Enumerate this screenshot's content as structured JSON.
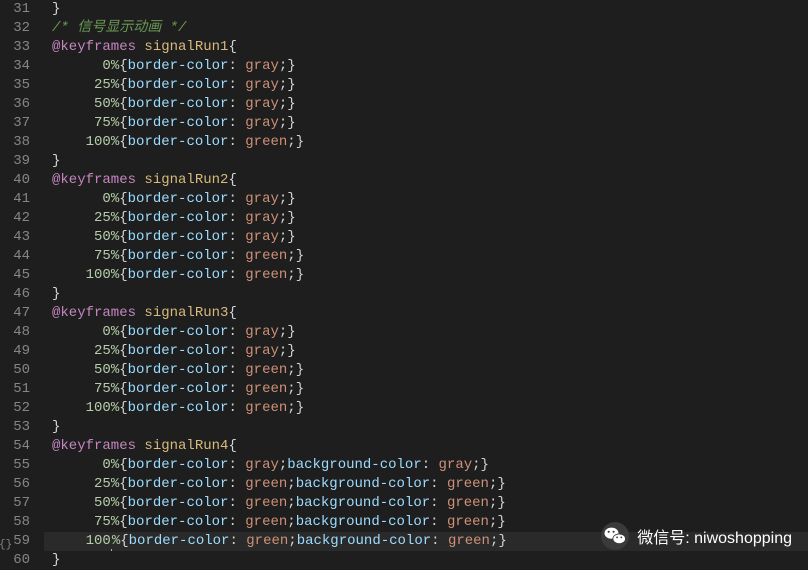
{
  "watermark": {
    "label": "微信号: niwoshopping"
  },
  "gutter": {
    "start": 31,
    "end": 60
  },
  "lines": [
    {
      "n": 31,
      "ind": 1,
      "tokens": [
        [
          "brace",
          "}"
        ]
      ]
    },
    {
      "n": 32,
      "ind": 1,
      "tokens": [
        [
          "comment",
          "/* 信号显示动画 */"
        ]
      ]
    },
    {
      "n": 33,
      "ind": 1,
      "tokens": [
        [
          "keyword",
          "@keyframes"
        ],
        [
          "sp",
          " "
        ],
        [
          "selector",
          "signalRun1"
        ],
        [
          "brace",
          "{"
        ]
      ]
    },
    {
      "n": 34,
      "ind": 3,
      "tokens": [
        [
          "num",
          "0"
        ],
        [
          "pct",
          "%"
        ],
        [
          "brace",
          "{"
        ],
        [
          "prop",
          "border-color"
        ],
        [
          "colon",
          ": "
        ],
        [
          "value",
          "gray"
        ],
        [
          "semi",
          ";"
        ],
        [
          "brace",
          "}"
        ]
      ]
    },
    {
      "n": 35,
      "ind": 3,
      "tokens": [
        [
          "num",
          "25"
        ],
        [
          "pct",
          "%"
        ],
        [
          "brace",
          "{"
        ],
        [
          "prop",
          "border-color"
        ],
        [
          "colon",
          ": "
        ],
        [
          "value",
          "gray"
        ],
        [
          "semi",
          ";"
        ],
        [
          "brace",
          "}"
        ]
      ]
    },
    {
      "n": 36,
      "ind": 3,
      "tokens": [
        [
          "num",
          "50"
        ],
        [
          "pct",
          "%"
        ],
        [
          "brace",
          "{"
        ],
        [
          "prop",
          "border-color"
        ],
        [
          "colon",
          ": "
        ],
        [
          "value",
          "gray"
        ],
        [
          "semi",
          ";"
        ],
        [
          "brace",
          "}"
        ]
      ]
    },
    {
      "n": 37,
      "ind": 3,
      "tokens": [
        [
          "num",
          "75"
        ],
        [
          "pct",
          "%"
        ],
        [
          "brace",
          "{"
        ],
        [
          "prop",
          "border-color"
        ],
        [
          "colon",
          ": "
        ],
        [
          "value",
          "gray"
        ],
        [
          "semi",
          ";"
        ],
        [
          "brace",
          "}"
        ]
      ]
    },
    {
      "n": 38,
      "ind": 3,
      "tokens": [
        [
          "num",
          "100"
        ],
        [
          "pct",
          "%"
        ],
        [
          "brace",
          "{"
        ],
        [
          "prop",
          "border-color"
        ],
        [
          "colon",
          ": "
        ],
        [
          "value",
          "green"
        ],
        [
          "semi",
          ";"
        ],
        [
          "brace",
          "}"
        ]
      ]
    },
    {
      "n": 39,
      "ind": 1,
      "tokens": [
        [
          "brace",
          "}"
        ]
      ]
    },
    {
      "n": 40,
      "ind": 1,
      "tokens": [
        [
          "keyword",
          "@keyframes"
        ],
        [
          "sp",
          " "
        ],
        [
          "selector",
          "signalRun2"
        ],
        [
          "brace",
          "{"
        ]
      ]
    },
    {
      "n": 41,
      "ind": 3,
      "tokens": [
        [
          "num",
          "0"
        ],
        [
          "pct",
          "%"
        ],
        [
          "brace",
          "{"
        ],
        [
          "prop",
          "border-color"
        ],
        [
          "colon",
          ": "
        ],
        [
          "value",
          "gray"
        ],
        [
          "semi",
          ";"
        ],
        [
          "brace",
          "}"
        ]
      ]
    },
    {
      "n": 42,
      "ind": 3,
      "tokens": [
        [
          "num",
          "25"
        ],
        [
          "pct",
          "%"
        ],
        [
          "brace",
          "{"
        ],
        [
          "prop",
          "border-color"
        ],
        [
          "colon",
          ": "
        ],
        [
          "value",
          "gray"
        ],
        [
          "semi",
          ";"
        ],
        [
          "brace",
          "}"
        ]
      ]
    },
    {
      "n": 43,
      "ind": 3,
      "tokens": [
        [
          "num",
          "50"
        ],
        [
          "pct",
          "%"
        ],
        [
          "brace",
          "{"
        ],
        [
          "prop",
          "border-color"
        ],
        [
          "colon",
          ": "
        ],
        [
          "value",
          "gray"
        ],
        [
          "semi",
          ";"
        ],
        [
          "brace",
          "}"
        ]
      ]
    },
    {
      "n": 44,
      "ind": 3,
      "tokens": [
        [
          "num",
          "75"
        ],
        [
          "pct",
          "%"
        ],
        [
          "brace",
          "{"
        ],
        [
          "prop",
          "border-color"
        ],
        [
          "colon",
          ": "
        ],
        [
          "value",
          "green"
        ],
        [
          "semi",
          ";"
        ],
        [
          "brace",
          "}"
        ]
      ]
    },
    {
      "n": 45,
      "ind": 3,
      "tokens": [
        [
          "num",
          "100"
        ],
        [
          "pct",
          "%"
        ],
        [
          "brace",
          "{"
        ],
        [
          "prop",
          "border-color"
        ],
        [
          "colon",
          ": "
        ],
        [
          "value",
          "green"
        ],
        [
          "semi",
          ";"
        ],
        [
          "brace",
          "}"
        ]
      ]
    },
    {
      "n": 46,
      "ind": 1,
      "tokens": [
        [
          "brace",
          "}"
        ]
      ]
    },
    {
      "n": 47,
      "ind": 1,
      "tokens": [
        [
          "keyword",
          "@keyframes"
        ],
        [
          "sp",
          " "
        ],
        [
          "selector",
          "signalRun3"
        ],
        [
          "brace",
          "{"
        ]
      ]
    },
    {
      "n": 48,
      "ind": 3,
      "tokens": [
        [
          "num",
          "0"
        ],
        [
          "pct",
          "%"
        ],
        [
          "brace",
          "{"
        ],
        [
          "prop",
          "border-color"
        ],
        [
          "colon",
          ": "
        ],
        [
          "value",
          "gray"
        ],
        [
          "semi",
          ";"
        ],
        [
          "brace",
          "}"
        ]
      ]
    },
    {
      "n": 49,
      "ind": 3,
      "tokens": [
        [
          "num",
          "25"
        ],
        [
          "pct",
          "%"
        ],
        [
          "brace",
          "{"
        ],
        [
          "prop",
          "border-color"
        ],
        [
          "colon",
          ": "
        ],
        [
          "value",
          "gray"
        ],
        [
          "semi",
          ";"
        ],
        [
          "brace",
          "}"
        ]
      ]
    },
    {
      "n": 50,
      "ind": 3,
      "tokens": [
        [
          "num",
          "50"
        ],
        [
          "pct",
          "%"
        ],
        [
          "brace",
          "{"
        ],
        [
          "prop",
          "border-color"
        ],
        [
          "colon",
          ": "
        ],
        [
          "value",
          "green"
        ],
        [
          "semi",
          ";"
        ],
        [
          "brace",
          "}"
        ]
      ]
    },
    {
      "n": 51,
      "ind": 3,
      "tokens": [
        [
          "num",
          "75"
        ],
        [
          "pct",
          "%"
        ],
        [
          "brace",
          "{"
        ],
        [
          "prop",
          "border-color"
        ],
        [
          "colon",
          ": "
        ],
        [
          "value",
          "green"
        ],
        [
          "semi",
          ";"
        ],
        [
          "brace",
          "}"
        ]
      ]
    },
    {
      "n": 52,
      "ind": 3,
      "tokens": [
        [
          "num",
          "100"
        ],
        [
          "pct",
          "%"
        ],
        [
          "brace",
          "{"
        ],
        [
          "prop",
          "border-color"
        ],
        [
          "colon",
          ": "
        ],
        [
          "value",
          "green"
        ],
        [
          "semi",
          ";"
        ],
        [
          "brace",
          "}"
        ]
      ]
    },
    {
      "n": 53,
      "ind": 1,
      "tokens": [
        [
          "brace",
          "}"
        ]
      ]
    },
    {
      "n": 54,
      "ind": 1,
      "tokens": [
        [
          "keyword",
          "@keyframes"
        ],
        [
          "sp",
          " "
        ],
        [
          "selector",
          "signalRun4"
        ],
        [
          "brace",
          "{"
        ]
      ]
    },
    {
      "n": 55,
      "ind": 3,
      "tokens": [
        [
          "num",
          "0"
        ],
        [
          "pct",
          "%"
        ],
        [
          "brace",
          "{"
        ],
        [
          "prop",
          "border-color"
        ],
        [
          "colon",
          ": "
        ],
        [
          "value",
          "gray"
        ],
        [
          "semi",
          ";"
        ],
        [
          "prop",
          "background-color"
        ],
        [
          "colon",
          ": "
        ],
        [
          "value",
          "gray"
        ],
        [
          "semi",
          ";"
        ],
        [
          "brace",
          "}"
        ]
      ]
    },
    {
      "n": 56,
      "ind": 3,
      "tokens": [
        [
          "num",
          "25"
        ],
        [
          "pct",
          "%"
        ],
        [
          "brace",
          "{"
        ],
        [
          "prop",
          "border-color"
        ],
        [
          "colon",
          ": "
        ],
        [
          "value",
          "green"
        ],
        [
          "semi",
          ";"
        ],
        [
          "prop",
          "background-color"
        ],
        [
          "colon",
          ": "
        ],
        [
          "value",
          "green"
        ],
        [
          "semi",
          ";"
        ],
        [
          "brace",
          "}"
        ]
      ]
    },
    {
      "n": 57,
      "ind": 3,
      "tokens": [
        [
          "num",
          "50"
        ],
        [
          "pct",
          "%"
        ],
        [
          "brace",
          "{"
        ],
        [
          "prop",
          "border-color"
        ],
        [
          "colon",
          ": "
        ],
        [
          "value",
          "green"
        ],
        [
          "semi",
          ";"
        ],
        [
          "prop",
          "background-color"
        ],
        [
          "colon",
          ": "
        ],
        [
          "value",
          "green"
        ],
        [
          "semi",
          ";"
        ],
        [
          "brace",
          "}"
        ]
      ]
    },
    {
      "n": 58,
      "ind": 3,
      "tokens": [
        [
          "num",
          "75"
        ],
        [
          "pct",
          "%"
        ],
        [
          "brace",
          "{"
        ],
        [
          "prop",
          "border-color"
        ],
        [
          "colon",
          ": "
        ],
        [
          "value",
          "green"
        ],
        [
          "semi",
          ";"
        ],
        [
          "prop",
          "background-color"
        ],
        [
          "colon",
          ": "
        ],
        [
          "value",
          "green"
        ],
        [
          "semi",
          ";"
        ],
        [
          "brace",
          "}"
        ]
      ]
    },
    {
      "n": 59,
      "ind": 3,
      "hl": true,
      "cursor": true,
      "tokens": [
        [
          "num",
          "100"
        ],
        [
          "pct",
          "%"
        ],
        [
          "brace",
          "{"
        ],
        [
          "prop",
          "border-color"
        ],
        [
          "colon",
          ": "
        ],
        [
          "value",
          "green"
        ],
        [
          "semi",
          ";"
        ],
        [
          "prop",
          "background-color"
        ],
        [
          "colon",
          ": "
        ],
        [
          "value",
          "green"
        ],
        [
          "semi",
          ";"
        ],
        [
          "brace",
          "}"
        ]
      ]
    },
    {
      "n": 60,
      "ind": 1,
      "tokens": [
        [
          "brace",
          "}"
        ]
      ]
    }
  ],
  "folding_glyph": "{}"
}
